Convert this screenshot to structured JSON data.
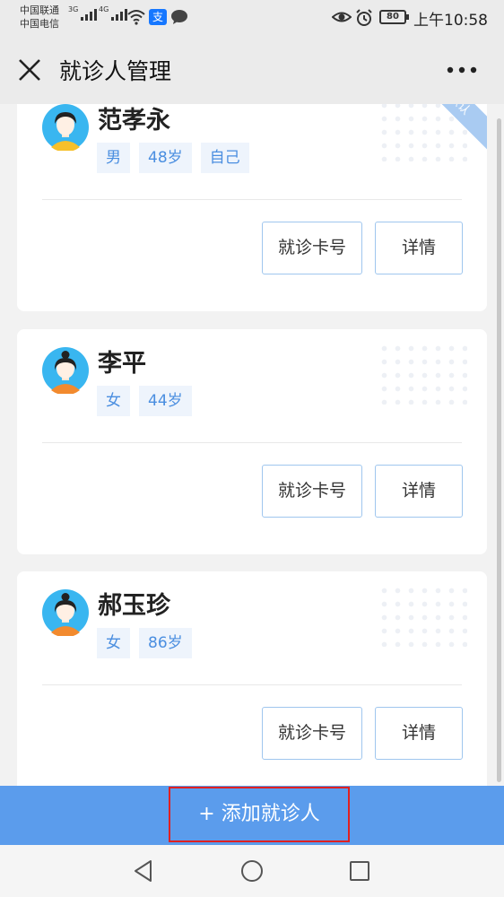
{
  "status": {
    "carrier1": "中国联通",
    "carrier2": "中国电信",
    "net1": "3G",
    "net2": "4G",
    "alipay_glyph": "支",
    "battery": "80",
    "time": "上午10:58"
  },
  "header": {
    "title": "就诊人管理"
  },
  "patients": [
    {
      "name": "范孝永",
      "gender": "男",
      "age": "48岁",
      "relation": "自己",
      "badge": "默认",
      "avatar": "male-avatar",
      "card_label": "就诊卡号",
      "detail_label": "详情"
    },
    {
      "name": "李平",
      "gender": "女",
      "age": "44岁",
      "avatar": "female-avatar",
      "card_label": "就诊卡号",
      "detail_label": "详情"
    },
    {
      "name": "郝玉珍",
      "gender": "女",
      "age": "86岁",
      "avatar": "female-avatar",
      "card_label": "就诊卡号",
      "detail_label": "详情"
    }
  ],
  "add_button": {
    "label": "+ 添加就诊人"
  },
  "colors": {
    "accent": "#5b9cec",
    "tag_text": "#4a8ee0",
    "tag_bg": "#eef4fc",
    "highlight": "#e02020"
  }
}
